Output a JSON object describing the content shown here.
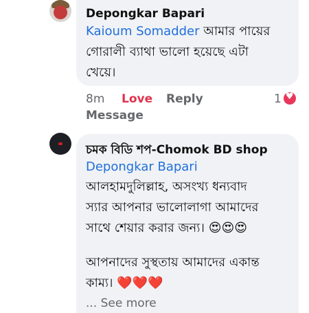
{
  "comment1": {
    "author": "Depongkar Bapari",
    "mention": "Kaioum Somadder",
    "text_line1_rest": " আমার পায়ের",
    "text_line2": "গোরালী ব্যাথা ভালো হয়েছে  এটা",
    "text_line3": "খেয়ে।",
    "time": "8m",
    "love_label": "Love",
    "reply_label": "Reply",
    "reaction_count": "1",
    "message_label": "Message"
  },
  "comment2": {
    "author": "চমক বিডি শপ-Chomok BD shop",
    "mention": "Depongkar Bapari",
    "line1": "আলহামদুলিল্লাহ, অসংখ্য ধন্যবাদ",
    "line2": "স্যার  আপনার ভালোলাগা আমাদের",
    "line3": "সাথে শেয়ার করার জন্য।",
    "line3_emoji": "😍😍😍",
    "line4": "আপনাদের সুস্থতায় আমাদের একান্ত",
    "line5": "কাম্য।",
    "line5_emoji": "❤️❤️❤️",
    "see_more": "... See more"
  }
}
